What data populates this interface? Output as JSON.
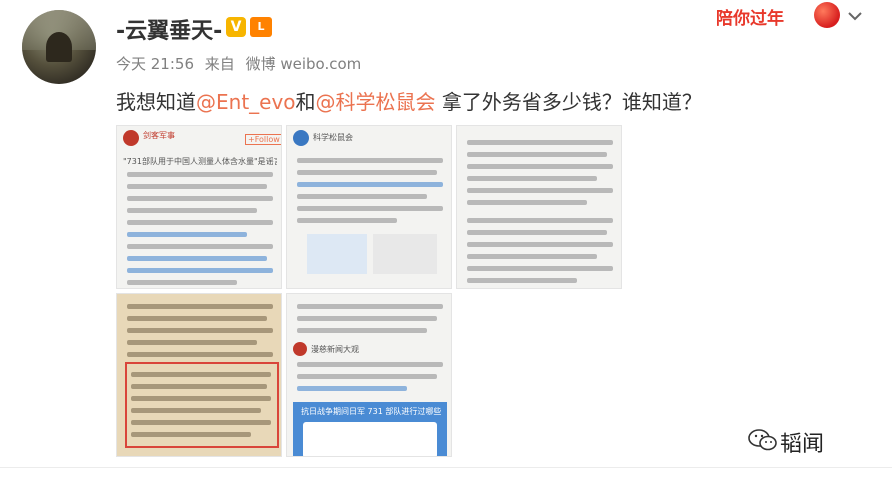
{
  "user": {
    "name": "-云翼垂天-",
    "verified_badge": "V",
    "level_badge": "L"
  },
  "meta": {
    "time": "今天 21:56",
    "source_prefix": "来自",
    "source": "微博 weibo.com"
  },
  "promo": {
    "text": "陪你过年"
  },
  "post": {
    "prefix": "我想知道",
    "mention1": "@Ent_evo",
    "connector": "和",
    "mention2": "@科学松鼠会",
    "suffix": " 拿了外务省多少钱？谁知道？"
  },
  "images": {
    "img1": {
      "author": "剑客军事",
      "follow": "+Follow",
      "snippet": "\"731部队用于中国人测量人体含水量\"是谣言？"
    },
    "img2": {
      "author": "科学松鼠会",
      "snippet": ""
    },
    "img3": {
      "snippet": ""
    },
    "img4": {
      "snippet": ""
    },
    "img5": {
      "author": "漫慈新闻大观",
      "banner": "抗日战争期间日军 731 部队进行过哪些残忍试验？"
    }
  },
  "watermark": {
    "text": "韬闻"
  },
  "colors": {
    "mention": "#eb7350",
    "username": "#333333",
    "meta": "#808080"
  }
}
